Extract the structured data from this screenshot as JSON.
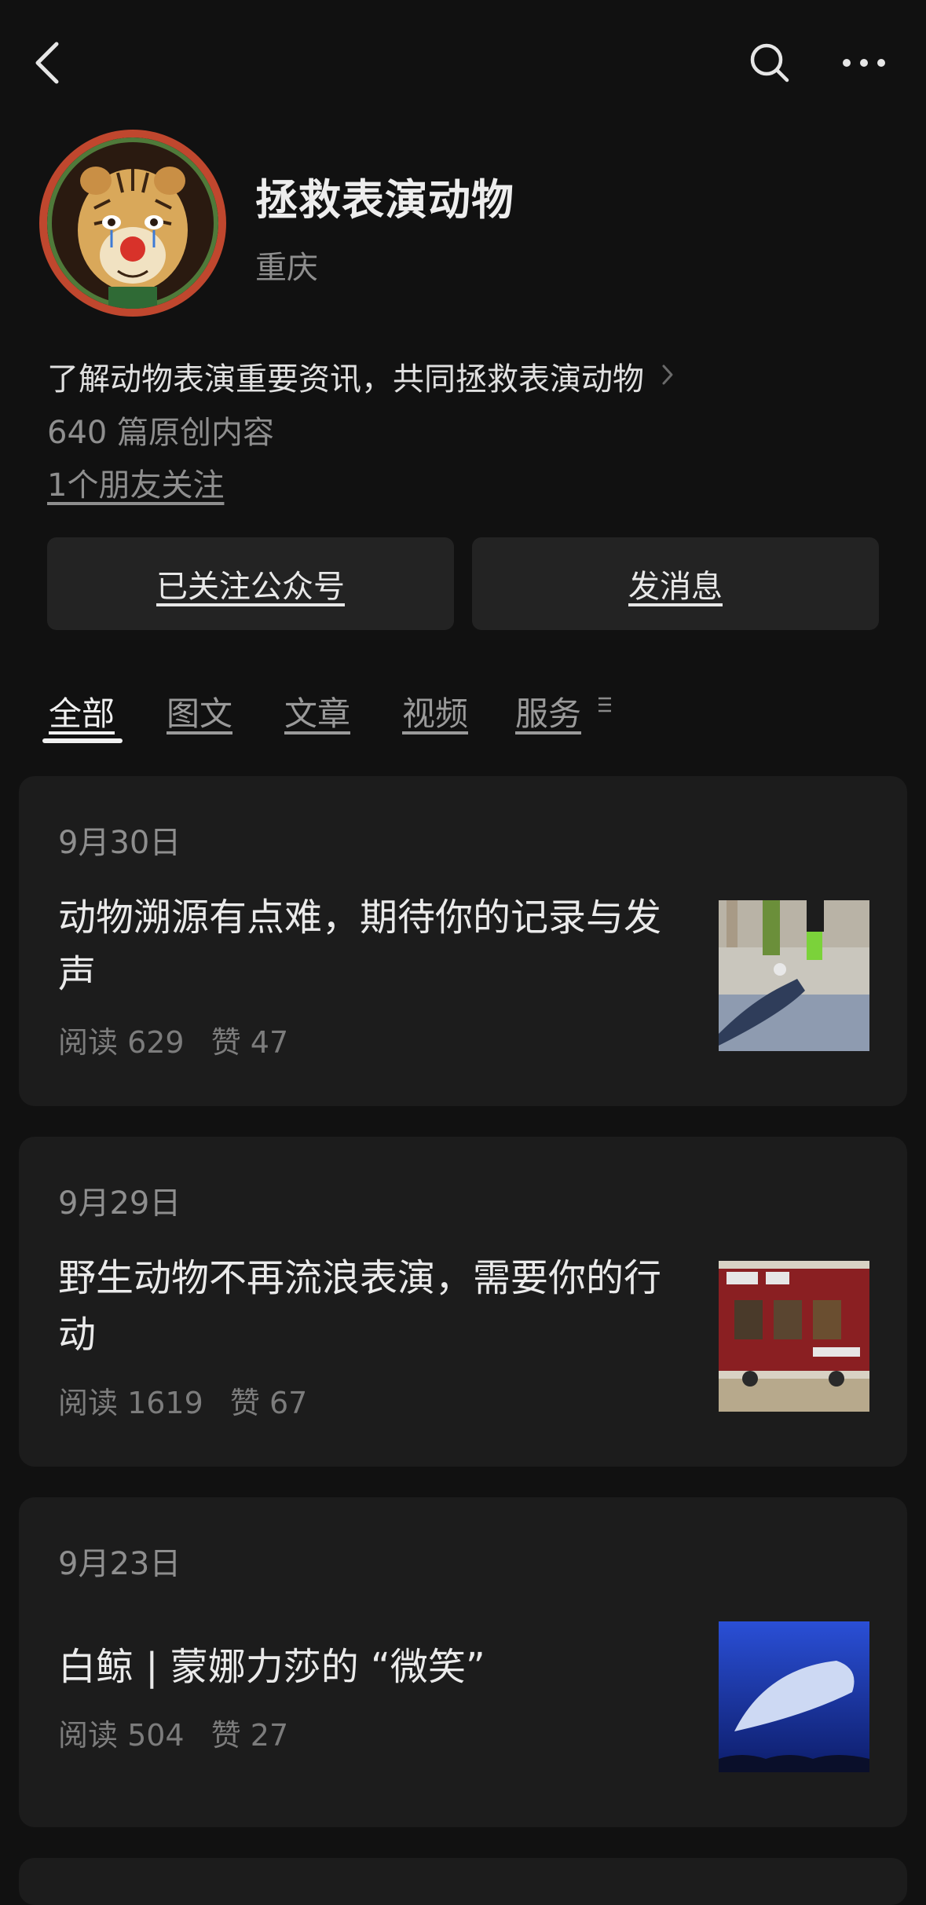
{
  "account": {
    "name": "拯救表演动物",
    "location": "重庆",
    "description": "了解动物表演重要资讯，共同拯救表演动物",
    "original_count": "640 篇原创内容",
    "friends_follow": "1个朋友关注"
  },
  "actions": {
    "follow_label": "已关注公众号",
    "message_label": "发消息"
  },
  "tabs": [
    {
      "label": "全部",
      "active": true
    },
    {
      "label": "图文",
      "active": false
    },
    {
      "label": "文章",
      "active": false
    },
    {
      "label": "视频",
      "active": false
    },
    {
      "label": "服务",
      "active": false
    }
  ],
  "articles": [
    {
      "date": "9月30日",
      "title": "动物溯源有点难，期待你的记录与发声",
      "reads": "阅读 629",
      "likes": "赞 47"
    },
    {
      "date": "9月29日",
      "title": "野生动物不再流浪表演，需要你的行动",
      "reads": "阅读 1619",
      "likes": "赞 67"
    },
    {
      "date": "9月23日",
      "title": "白鲸 | 蒙娜力莎的 “微笑”",
      "reads": "阅读 504",
      "likes": "赞 27"
    }
  ],
  "icons": {
    "back": "back-arrow-icon",
    "search": "search-icon",
    "more": "more-dots-icon",
    "chevron": "chevron-right-icon",
    "tab_menu": "tab-menu-icon"
  }
}
